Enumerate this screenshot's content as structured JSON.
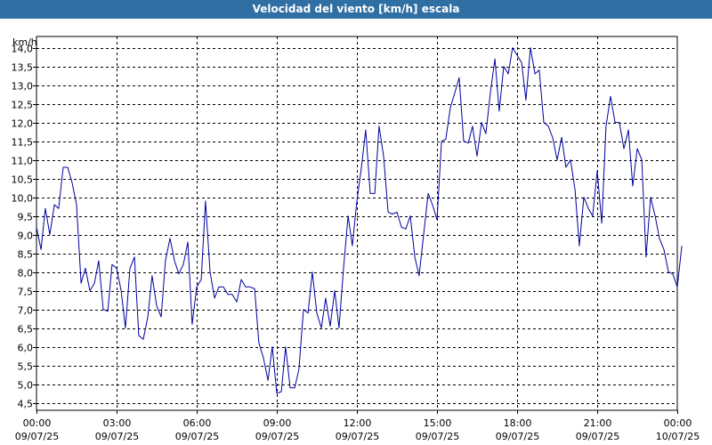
{
  "chart_data": {
    "type": "line",
    "title": "Velocidad del viento [km/h] escala",
    "ylabel": "km/h",
    "xlabel": "",
    "ylim": [
      4.3,
      14.3
    ],
    "y_ticks": [
      "4,5",
      "5,0",
      "5,5",
      "6,0",
      "6,5",
      "7,0",
      "7,5",
      "8,0",
      "8,5",
      "9,0",
      "9,5",
      "10,0",
      "10,5",
      "11,0",
      "11,5",
      "12,0",
      "12,5",
      "13,0",
      "13,5",
      "14,0"
    ],
    "y_tick_values": [
      4.5,
      5.0,
      5.5,
      6.0,
      6.5,
      7.0,
      7.5,
      8.0,
      8.5,
      9.0,
      9.5,
      10.0,
      10.5,
      11.0,
      11.5,
      12.0,
      12.5,
      13.0,
      13.5,
      14.0
    ],
    "x_range_hours": [
      0,
      24
    ],
    "x_ticks": [
      {
        "time": "00:00",
        "date": "09/07/25",
        "hour": 0
      },
      {
        "time": "03:00",
        "date": "09/07/25",
        "hour": 3
      },
      {
        "time": "06:00",
        "date": "09/07/25",
        "hour": 6
      },
      {
        "time": "09:00",
        "date": "09/07/25",
        "hour": 9
      },
      {
        "time": "12:00",
        "date": "09/07/25",
        "hour": 12
      },
      {
        "time": "15:00",
        "date": "09/07/25",
        "hour": 15
      },
      {
        "time": "18:00",
        "date": "09/07/25",
        "hour": 18
      },
      {
        "time": "21:00",
        "date": "09/07/25",
        "hour": 21
      },
      {
        "time": "00:00",
        "date": "10/07/25",
        "hour": 24
      }
    ],
    "grid": true,
    "series_color": "#0000a0",
    "series": [
      {
        "values": [
          [
            0.0,
            9.2
          ],
          [
            0.17,
            8.6
          ],
          [
            0.33,
            9.7
          ],
          [
            0.5,
            9.0
          ],
          [
            0.67,
            9.8
          ],
          [
            0.83,
            9.7
          ],
          [
            1.0,
            10.8
          ],
          [
            1.17,
            10.8
          ],
          [
            1.33,
            10.4
          ],
          [
            1.5,
            9.8
          ],
          [
            1.67,
            7.7
          ],
          [
            1.83,
            8.1
          ],
          [
            2.0,
            7.5
          ],
          [
            2.17,
            7.7
          ],
          [
            2.33,
            8.3
          ],
          [
            2.5,
            7.0
          ],
          [
            2.67,
            6.95
          ],
          [
            2.83,
            8.2
          ],
          [
            3.0,
            8.1
          ],
          [
            3.17,
            7.5
          ],
          [
            3.33,
            6.5
          ],
          [
            3.5,
            8.1
          ],
          [
            3.67,
            8.4
          ],
          [
            3.83,
            6.3
          ],
          [
            4.0,
            6.2
          ],
          [
            4.17,
            6.8
          ],
          [
            4.33,
            7.9
          ],
          [
            4.5,
            7.1
          ],
          [
            4.67,
            6.8
          ],
          [
            4.83,
            8.3
          ],
          [
            5.0,
            8.9
          ],
          [
            5.17,
            8.3
          ],
          [
            5.33,
            7.95
          ],
          [
            5.5,
            8.2
          ],
          [
            5.67,
            8.8
          ],
          [
            5.83,
            6.6
          ],
          [
            6.0,
            7.6
          ],
          [
            6.17,
            7.8
          ],
          [
            6.33,
            9.9
          ],
          [
            6.5,
            8.0
          ],
          [
            6.67,
            7.3
          ],
          [
            6.83,
            7.6
          ],
          [
            7.0,
            7.6
          ],
          [
            7.17,
            7.4
          ],
          [
            7.33,
            7.4
          ],
          [
            7.5,
            7.2
          ],
          [
            7.67,
            7.8
          ],
          [
            7.83,
            7.6
          ],
          [
            8.0,
            7.6
          ],
          [
            8.17,
            7.55
          ],
          [
            8.33,
            6.1
          ],
          [
            8.5,
            5.7
          ],
          [
            8.67,
            5.1
          ],
          [
            8.83,
            6.0
          ],
          [
            9.0,
            4.75
          ],
          [
            9.17,
            4.8
          ],
          [
            9.33,
            6.0
          ],
          [
            9.5,
            4.9
          ],
          [
            9.67,
            4.9
          ],
          [
            9.83,
            5.4
          ],
          [
            10.0,
            7.0
          ],
          [
            10.17,
            6.9
          ],
          [
            10.33,
            8.0
          ],
          [
            10.5,
            6.9
          ],
          [
            10.67,
            6.5
          ],
          [
            10.83,
            7.3
          ],
          [
            11.0,
            6.55
          ],
          [
            11.17,
            7.5
          ],
          [
            11.33,
            6.5
          ],
          [
            11.5,
            8.1
          ],
          [
            11.67,
            9.5
          ],
          [
            11.83,
            8.7
          ],
          [
            12.0,
            9.9
          ],
          [
            12.17,
            10.8
          ],
          [
            12.33,
            11.8
          ],
          [
            12.5,
            10.1
          ],
          [
            12.67,
            10.1
          ],
          [
            12.83,
            11.9
          ],
          [
            13.0,
            11.1
          ],
          [
            13.17,
            9.6
          ],
          [
            13.33,
            9.55
          ],
          [
            13.5,
            9.6
          ],
          [
            13.67,
            9.2
          ],
          [
            13.83,
            9.15
          ],
          [
            14.0,
            9.5
          ],
          [
            14.17,
            8.4
          ],
          [
            14.33,
            7.9
          ],
          [
            14.5,
            9.0
          ],
          [
            14.67,
            10.1
          ],
          [
            14.83,
            9.8
          ],
          [
            15.0,
            9.4
          ],
          [
            15.17,
            11.5
          ],
          [
            15.33,
            11.55
          ],
          [
            15.5,
            12.4
          ],
          [
            15.67,
            12.8
          ],
          [
            15.83,
            13.2
          ],
          [
            16.0,
            11.5
          ],
          [
            16.17,
            11.45
          ],
          [
            16.33,
            11.9
          ],
          [
            16.5,
            11.1
          ],
          [
            16.67,
            12.0
          ],
          [
            16.83,
            11.7
          ],
          [
            17.0,
            12.8
          ],
          [
            17.17,
            13.7
          ],
          [
            17.33,
            12.3
          ],
          [
            17.5,
            13.5
          ],
          [
            17.67,
            13.3
          ],
          [
            17.83,
            14.0
          ],
          [
            18.0,
            13.8
          ],
          [
            18.17,
            13.6
          ],
          [
            18.33,
            12.6
          ],
          [
            18.5,
            14.0
          ],
          [
            18.67,
            13.3
          ],
          [
            18.83,
            13.4
          ],
          [
            19.0,
            12.0
          ],
          [
            19.17,
            11.9
          ],
          [
            19.33,
            11.6
          ],
          [
            19.5,
            11.0
          ],
          [
            19.67,
            11.6
          ],
          [
            19.83,
            10.8
          ],
          [
            20.0,
            11.0
          ],
          [
            20.17,
            10.2
          ],
          [
            20.33,
            8.7
          ],
          [
            20.5,
            10.0
          ],
          [
            20.67,
            9.7
          ],
          [
            20.83,
            9.5
          ],
          [
            21.0,
            10.7
          ],
          [
            21.17,
            9.3
          ],
          [
            21.33,
            11.9
          ],
          [
            21.5,
            12.7
          ],
          [
            21.67,
            12.0
          ],
          [
            21.83,
            12.0
          ],
          [
            22.0,
            11.3
          ],
          [
            22.17,
            11.8
          ],
          [
            22.33,
            10.3
          ],
          [
            22.5,
            11.3
          ],
          [
            22.67,
            11.0
          ],
          [
            22.83,
            8.4
          ],
          [
            23.0,
            10.0
          ],
          [
            23.17,
            9.5
          ],
          [
            23.33,
            8.9
          ],
          [
            23.5,
            8.6
          ],
          [
            23.67,
            8.0
          ],
          [
            23.83,
            7.95
          ],
          [
            24.0,
            7.6
          ],
          [
            24.17,
            8.7
          ]
        ]
      }
    ]
  }
}
